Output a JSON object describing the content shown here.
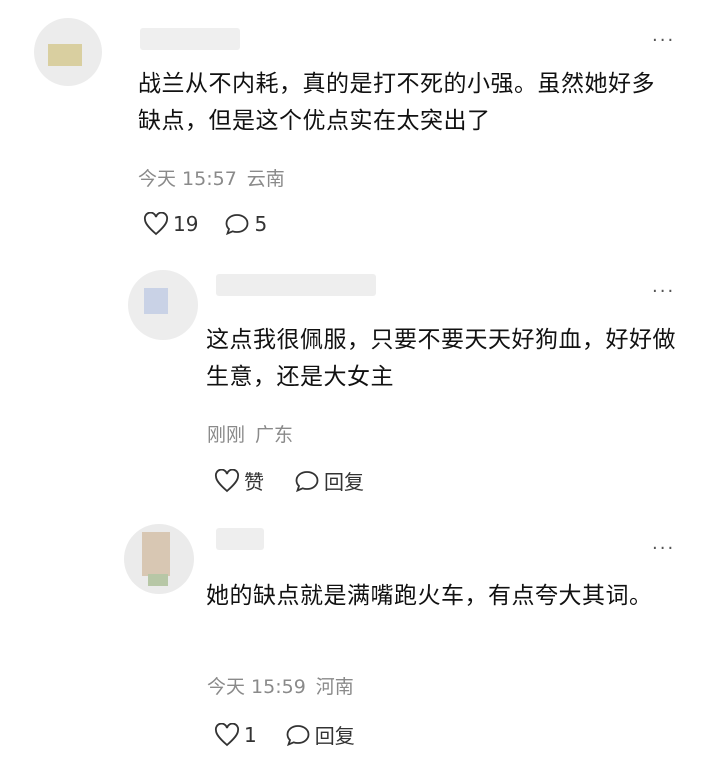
{
  "comments": [
    {
      "text": "战兰从不内耗，真的是打不死的小强。虽然她好多缺点，但是这个优点实在太突出了",
      "time": "今天 15:57",
      "location": "云南",
      "like_label": "19",
      "reply_label": "5",
      "more_label": "···"
    },
    {
      "text": "这点我很佩服，只要不要天天好狗血，好好做生意，还是大女主",
      "time": "刚刚",
      "location": "广东",
      "like_label": "赞",
      "reply_label": "回复",
      "more_label": "···"
    },
    {
      "text": "她的缺点就是满嘴跑火车，有点夸大其词。",
      "time": "今天 15:59",
      "location": "河南",
      "like_label": "1",
      "reply_label": "回复",
      "more_label": "···"
    }
  ]
}
